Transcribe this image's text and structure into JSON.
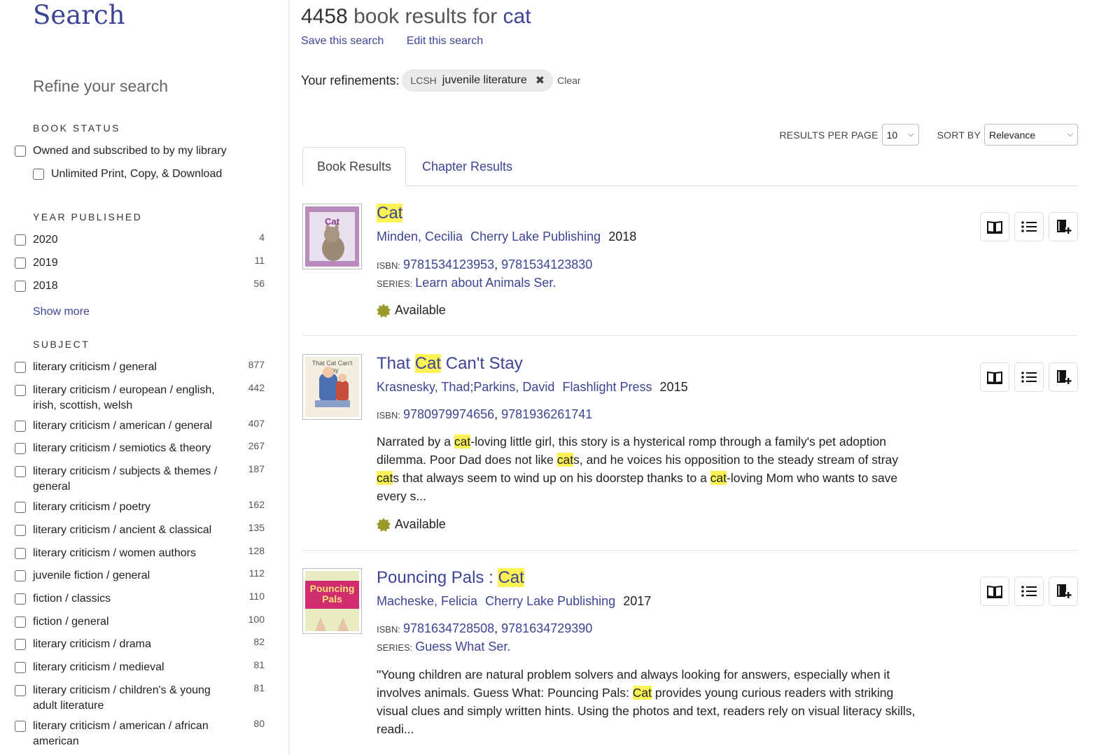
{
  "page": {
    "title": "Search",
    "results_count": "4458",
    "results_text": " book results for ",
    "query": "cat",
    "save_search": "Save this search",
    "edit_search": "Edit this search"
  },
  "refinements": {
    "label": "Your refinements:",
    "chip_key": "LCSH",
    "chip_value": "juvenile literature",
    "clear": "Clear"
  },
  "controls": {
    "per_page_label": "RESULTS PER PAGE",
    "per_page_value": "10",
    "sort_label": "SORT BY",
    "sort_value": "Relevance"
  },
  "tabs": {
    "book": "Book Results",
    "chapter": "Chapter Results"
  },
  "sidebar": {
    "refine_title": "Refine your search",
    "book_status": {
      "heading": "BOOK STATUS",
      "options": [
        "Owned and subscribed to by my library",
        "Unlimited Print, Copy, & Download"
      ]
    },
    "year": {
      "heading": "YEAR PUBLISHED",
      "items": [
        {
          "label": "2020",
          "count": "4"
        },
        {
          "label": "2019",
          "count": "11"
        },
        {
          "label": "2018",
          "count": "56"
        }
      ],
      "show_more": "Show more"
    },
    "subject": {
      "heading": "SUBJECT",
      "items": [
        {
          "label": "literary criticism / general",
          "count": "877"
        },
        {
          "label": "literary criticism / european / english, irish, scottish, welsh",
          "count": "442"
        },
        {
          "label": "literary criticism / american / general",
          "count": "407"
        },
        {
          "label": "literary criticism / semiotics & theory",
          "count": "267"
        },
        {
          "label": "literary criticism / subjects & themes / general",
          "count": "187"
        },
        {
          "label": "literary criticism / poetry",
          "count": "162"
        },
        {
          "label": "literary criticism / ancient & classical",
          "count": "135"
        },
        {
          "label": "literary criticism / women authors",
          "count": "128"
        },
        {
          "label": "juvenile fiction / general",
          "count": "112"
        },
        {
          "label": "fiction / classics",
          "count": "110"
        },
        {
          "label": "fiction / general",
          "count": "100"
        },
        {
          "label": "literary criticism / drama",
          "count": "82"
        },
        {
          "label": "literary criticism / medieval",
          "count": "81"
        },
        {
          "label": "literary criticism / children's & young adult literature",
          "count": "81"
        },
        {
          "label": "literary criticism / american / african american",
          "count": "80"
        }
      ]
    }
  },
  "results": [
    {
      "title_pre": "",
      "title_hl": "Cat",
      "title_post": "",
      "author": "Minden, Cecilia",
      "publisher": "Cherry Lake Publishing",
      "year": "2018",
      "isbn_label": "ISBN:",
      "isbn1": "9781534123953",
      "isbn2": "9781534123830",
      "series_label": "SERIES:",
      "series": "Learn about Animals Ser.",
      "availability": "Available",
      "cover_text": "Cat"
    },
    {
      "title_pre": "That ",
      "title_hl": "Cat",
      "title_post": " Can't Stay",
      "author": "Krasnesky, Thad;Parkins, David",
      "publisher": "Flashlight Press",
      "year": "2015",
      "isbn_label": "ISBN:",
      "isbn1": "9780979974656",
      "isbn2": "9781936261741",
      "description": [
        "Narrated by a ",
        "cat",
        "-loving little girl, this story is a hysterical romp through a family's pet adoption dilemma. Poor Dad does not like ",
        "cat",
        "s, and he voices his opposition to the steady stream of stray ",
        "cat",
        "s that always seem to wind up on his doorstep    thanks to a ",
        "cat",
        "-loving Mom who wants to save every s..."
      ],
      "availability": "Available",
      "cover_text": "That Cat Can't Stay"
    },
    {
      "title_pre": "Pouncing Pals : ",
      "title_hl": "Cat",
      "title_post": "",
      "author": "Macheske, Felicia",
      "publisher": "Cherry Lake Publishing",
      "year": "2017",
      "isbn_label": "ISBN:",
      "isbn1": "9781634728508",
      "isbn2": "9781634729390",
      "series_label": "SERIES:",
      "series": "Guess What Ser.",
      "description": [
        "\"Young children are natural problem solvers and always looking for answers, especially when it involves animals. Guess What: Pouncing Pals: ",
        "Cat",
        " provides young curious readers with striking visual clues and simply written hints. Using the photos and text, readers rely on visual literacy skills, readi..."
      ],
      "cover_text": "Pouncing Pals"
    }
  ],
  "colors": {
    "link": "#3d4494",
    "highlight": "#fbf255",
    "available_badge": "#9a9a2c"
  },
  "icons": [
    "book-open-icon",
    "list-icon",
    "add-to-shelf-icon",
    "checkbox-icon",
    "close-icon",
    "chevron-down-icon",
    "available-badge-icon"
  ]
}
